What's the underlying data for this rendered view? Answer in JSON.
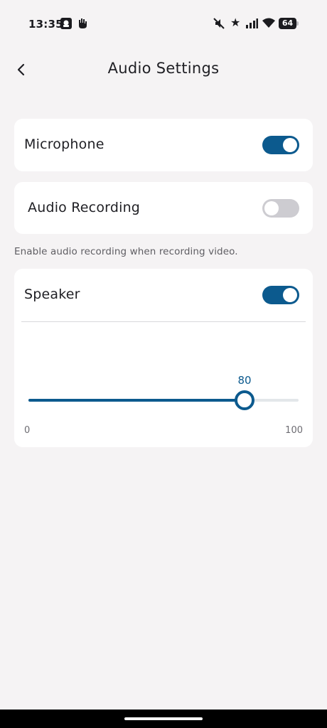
{
  "status_bar": {
    "time": "13:35",
    "battery_level": "64",
    "icons": [
      "notification-app-icon",
      "notification-hand-icon",
      "mute-icon",
      "star-icon",
      "signal-icon",
      "wifi-icon",
      "battery-icon"
    ]
  },
  "header": {
    "title": "Audio Settings",
    "back_icon": "chevron-left-icon"
  },
  "microphone": {
    "label": "Microphone",
    "enabled": true
  },
  "audio_recording": {
    "label": "Audio Recording",
    "enabled": false,
    "helper": "Enable audio recording when recording video."
  },
  "speaker": {
    "label": "Speaker",
    "enabled": true,
    "volume": {
      "value": 80,
      "value_label": "80",
      "min": 0,
      "max": 100,
      "min_label": "0",
      "max_label": "100"
    }
  },
  "colors": {
    "accent": "#0c5a8e",
    "background": "#f5f3f4",
    "card": "#ffffff",
    "toggle_off": "#cdccd1"
  }
}
